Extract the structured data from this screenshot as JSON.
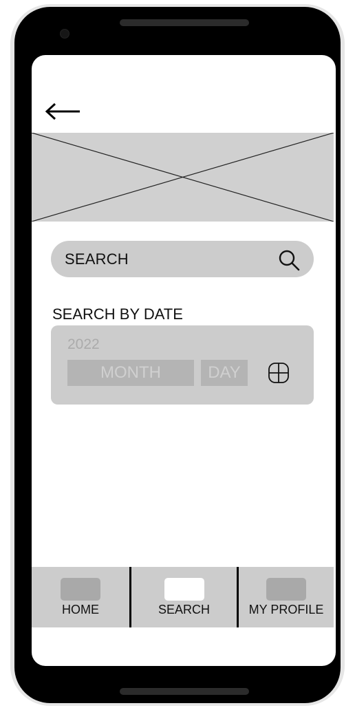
{
  "search": {
    "placeholder": "SEARCH"
  },
  "date_search": {
    "heading": "SEARCH BY DATE",
    "year": "2022",
    "month": "MONTH",
    "day": "DAY"
  },
  "nav": {
    "items": [
      {
        "label": "HOME"
      },
      {
        "label": "SEARCH"
      },
      {
        "label": "MY PROFILE"
      }
    ],
    "active": "SEARCH"
  },
  "icons": {
    "back": "back-arrow-icon",
    "search": "search-icon",
    "calendar": "calendar-icon"
  },
  "colors": {
    "frame": "#000000",
    "placeholder_gray": "#cccccc",
    "muted_text": "#ababab",
    "active_tab_icon": "#ffffff"
  }
}
